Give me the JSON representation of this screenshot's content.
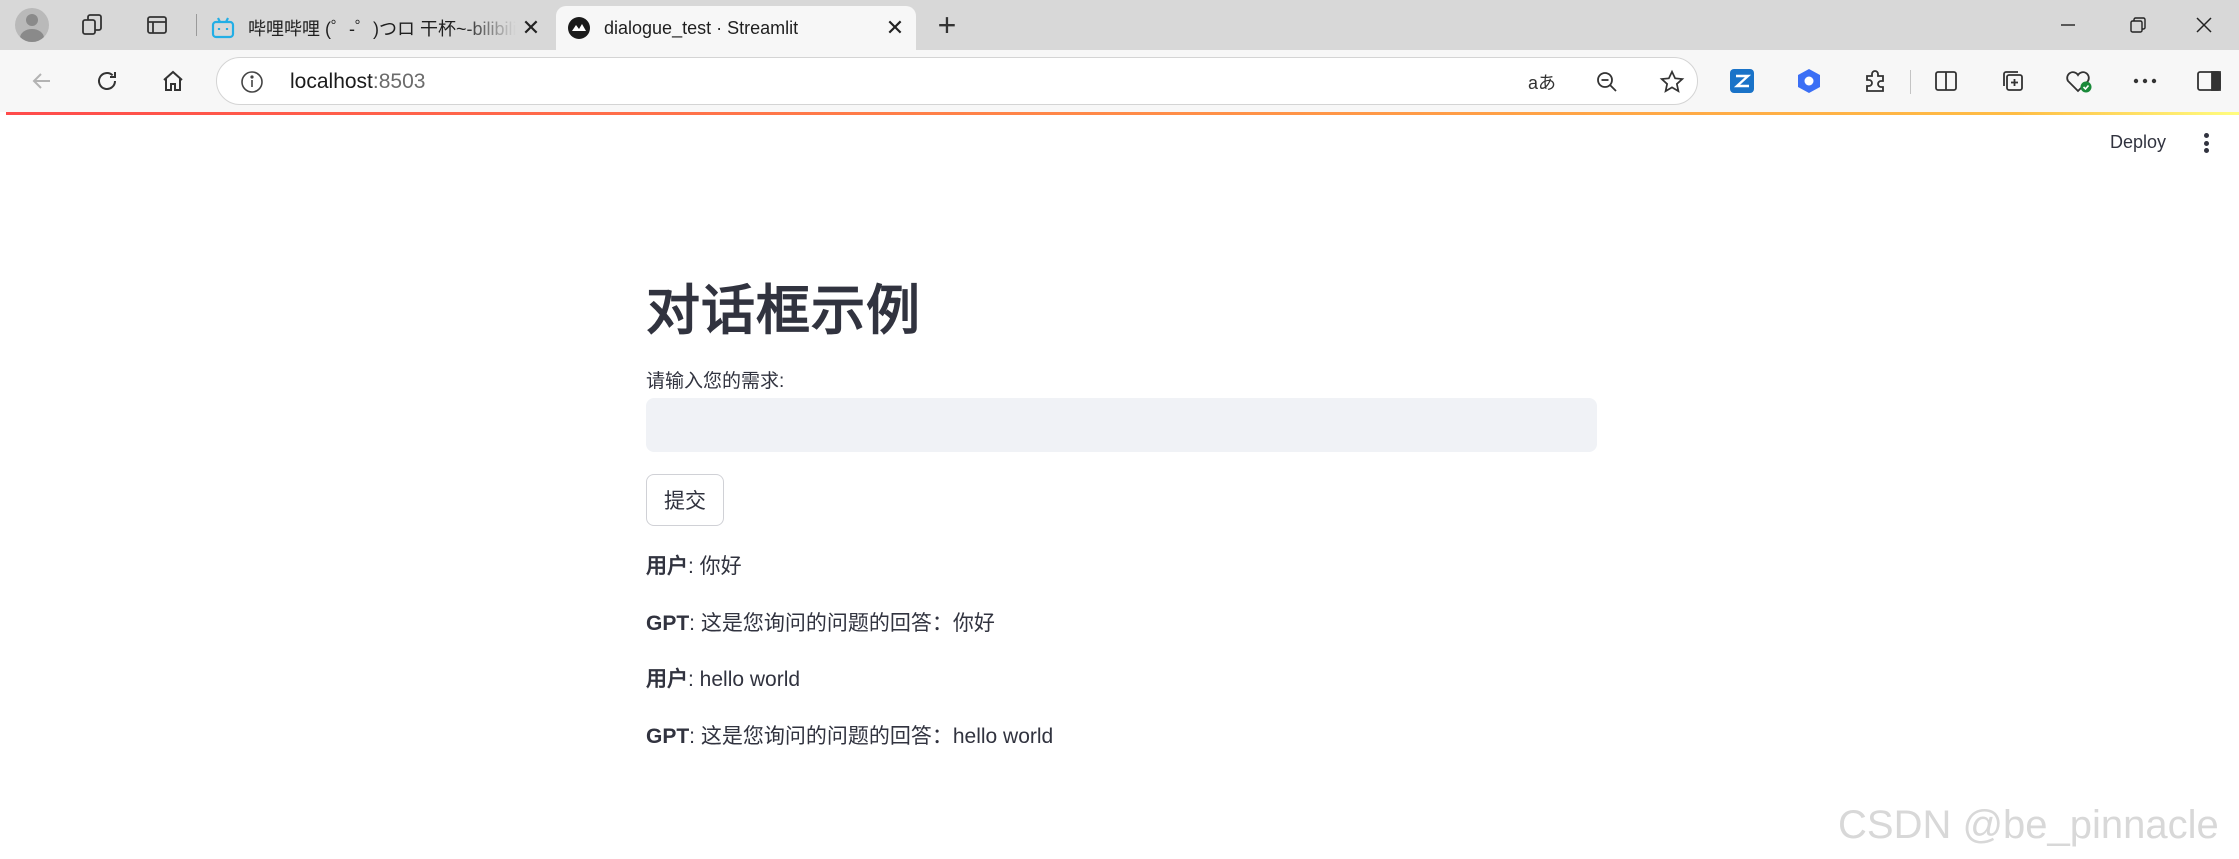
{
  "browser": {
    "tabs": [
      {
        "title": "哔哩哔哩 (゜-゜)つロ 干杯~-bilibili",
        "active": false,
        "icon": "bilibili-icon"
      },
      {
        "title": "dialogue_test · Streamlit",
        "active": true,
        "icon": "streamlit-icon"
      }
    ],
    "url_host": "localhost",
    "url_port": ":8503",
    "translate_glyph": "aあ"
  },
  "app": {
    "deploy_label": "Deploy",
    "title": "对话框示例",
    "input_label": "请输入您的需求:",
    "input_value": "",
    "submit_label": "提交",
    "messages": [
      {
        "speaker": "用户",
        "text": ": 你好"
      },
      {
        "speaker": "GPT",
        "text": ": 这是您询问的问题的回答：你好"
      },
      {
        "speaker": "用户",
        "text": ": hello world"
      },
      {
        "speaker": "GPT",
        "text": ": 这是您询问的问题的回答：hello world"
      }
    ]
  },
  "watermark": "CSDN @be_pinnacle",
  "colors": {
    "accent_gradient": [
      "#ff4b4b",
      "#ffbd45",
      "#fffd80"
    ],
    "text": "#31333f",
    "input_bg": "#f0f2f6"
  }
}
